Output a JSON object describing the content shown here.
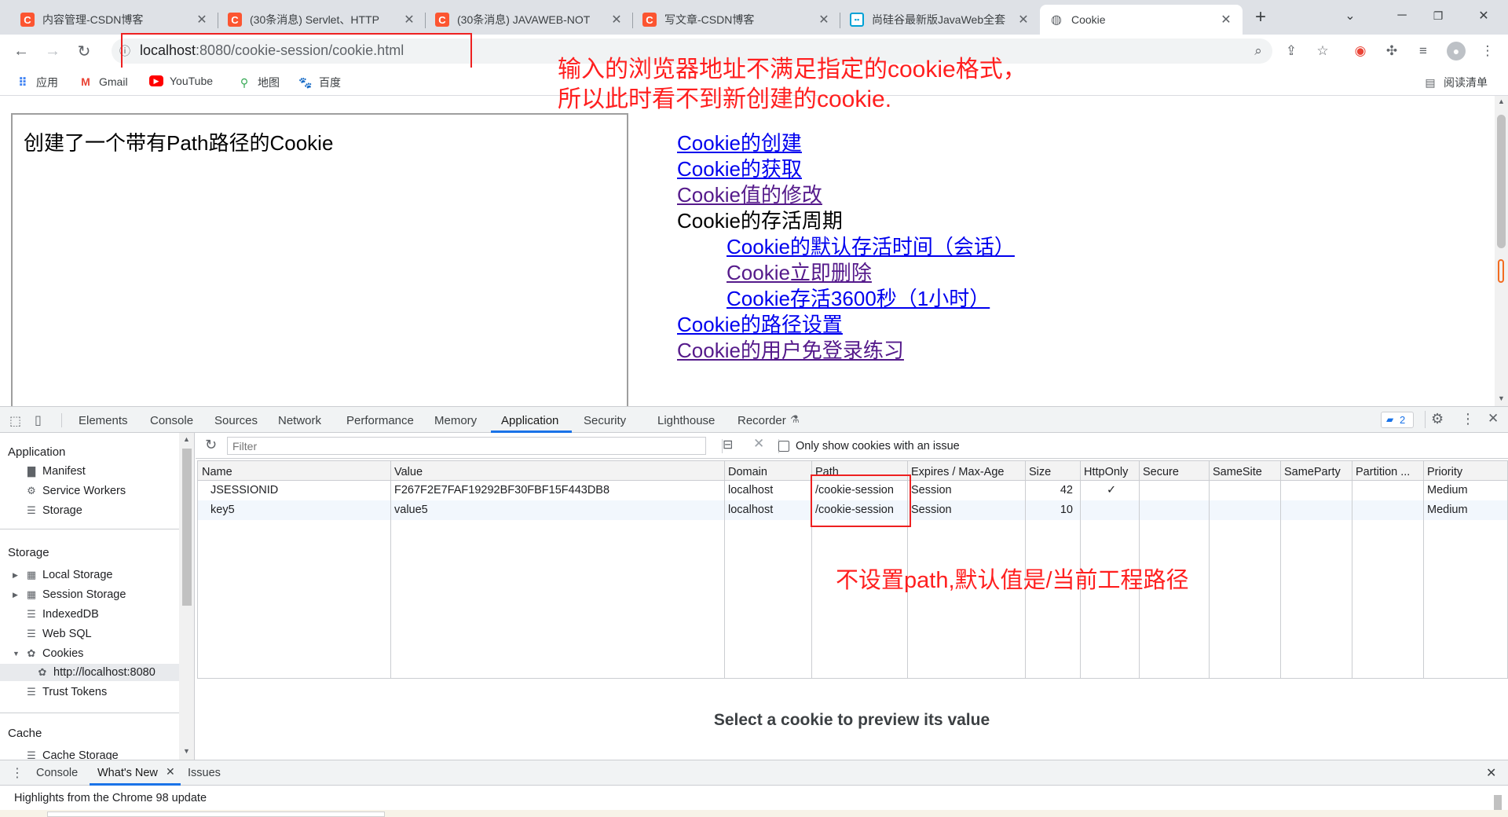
{
  "browser": {
    "tabs": [
      {
        "title": "内容管理-CSDN博客",
        "favicon": "C",
        "favicon_color": "#fc5531",
        "active": false
      },
      {
        "title": "(30条消息) Servlet、HTTP",
        "favicon": "C",
        "favicon_color": "#fc5531",
        "active": false
      },
      {
        "title": "(30条消息) JAVAWEB-NOT",
        "favicon": "C",
        "favicon_color": "#fc5531",
        "active": false
      },
      {
        "title": "写文章-CSDN博客",
        "favicon": "C",
        "favicon_color": "#fc5531",
        "active": false
      },
      {
        "title": "尚硅谷最新版JavaWeb全套",
        "favicon": "bilibili",
        "favicon_color": "#00a1d6",
        "active": false
      },
      {
        "title": "Cookie",
        "favicon": "globe",
        "favicon_color": "#5f6368",
        "active": true
      }
    ],
    "close_glyph": "✕",
    "new_tab_glyph": "+",
    "url_host": "localhost",
    "url_path": ":8080/cookie-session/cookie.html",
    "bookmarks": [
      {
        "label": "应用",
        "icon": "apps-icon"
      },
      {
        "label": "Gmail",
        "icon": "gmail-icon"
      },
      {
        "label": "YouTube",
        "icon": "youtube-icon"
      },
      {
        "label": "地图",
        "icon": "maps-icon"
      },
      {
        "label": "百度",
        "icon": "baidu-icon"
      }
    ],
    "reading_list": "阅读清单"
  },
  "page": {
    "iframe_text": "创建了一个带有Path路径的Cookie",
    "links": [
      {
        "label": "Cookie的创建",
        "type": "link",
        "indent": false,
        "visited": false
      },
      {
        "label": "Cookie的获取",
        "type": "link",
        "indent": false,
        "visited": false
      },
      {
        "label": "Cookie值的修改",
        "type": "link",
        "indent": false,
        "visited": true
      },
      {
        "label": "Cookie的存活周期",
        "type": "plain",
        "indent": false,
        "visited": false
      },
      {
        "label": "Cookie的默认存活时间（会话）",
        "type": "link",
        "indent": true,
        "visited": false
      },
      {
        "label": "Cookie立即删除",
        "type": "link",
        "indent": true,
        "visited": true
      },
      {
        "label": "Cookie存活3600秒（1小时）",
        "type": "link",
        "indent": true,
        "visited": false
      },
      {
        "label": "Cookie的路径设置",
        "type": "link",
        "indent": false,
        "visited": false
      },
      {
        "label": "Cookie的用户免登录练习",
        "type": "link",
        "indent": false,
        "visited": true
      }
    ]
  },
  "annotations": {
    "top_line1": "输入的浏览器地址不满足指定的cookie格式，",
    "top_line2": "所以此时看不到新创建的cookie.",
    "path_note": "不设置path,默认值是/当前工程路径",
    "color": "#ff1f1f"
  },
  "devtools": {
    "tabs": [
      "Elements",
      "Console",
      "Sources",
      "Network",
      "Performance",
      "Memory",
      "Application",
      "Security",
      "Lighthouse",
      "Recorder"
    ],
    "active_tab": "Application",
    "issues_count": "2",
    "sidebar": {
      "application_header": "Application",
      "application_items": [
        "Manifest",
        "Service Workers",
        "Storage"
      ],
      "storage_header": "Storage",
      "storage_items": [
        "Local Storage",
        "Session Storage",
        "IndexedDB",
        "Web SQL",
        "Cookies"
      ],
      "cookie_origin": "http://localhost:8080",
      "trust_tokens": "Trust Tokens",
      "cache_header": "Cache",
      "cache_items": [
        "Cache Storage"
      ]
    },
    "filter_placeholder": "Filter",
    "only_issue_label": "Only show cookies with an issue",
    "columns": [
      "Name",
      "Value",
      "Domain",
      "Path",
      "Expires / Max-Age",
      "Size",
      "HttpOnly",
      "Secure",
      "SameSite",
      "SameParty",
      "Partition ...",
      "Priority"
    ],
    "cookies": [
      {
        "name": "JSESSIONID",
        "value": "F267F2E7FAF19292BF30FBF15F443DB8",
        "domain": "localhost",
        "path": "/cookie-session",
        "expires": "Session",
        "size": "42",
        "httponly": "✓",
        "priority": "Medium"
      },
      {
        "name": "key5",
        "value": "value5",
        "domain": "localhost",
        "path": "/cookie-session",
        "expires": "Session",
        "size": "10",
        "httponly": "",
        "priority": "Medium"
      }
    ],
    "preview_text": "Select a cookie to preview its value",
    "drawer_tabs": [
      "Console",
      "What's New",
      "Issues"
    ],
    "drawer_active": "What's New",
    "drawer_text": "Highlights from the Chrome 98 update",
    "accent": "#1a73e8"
  }
}
